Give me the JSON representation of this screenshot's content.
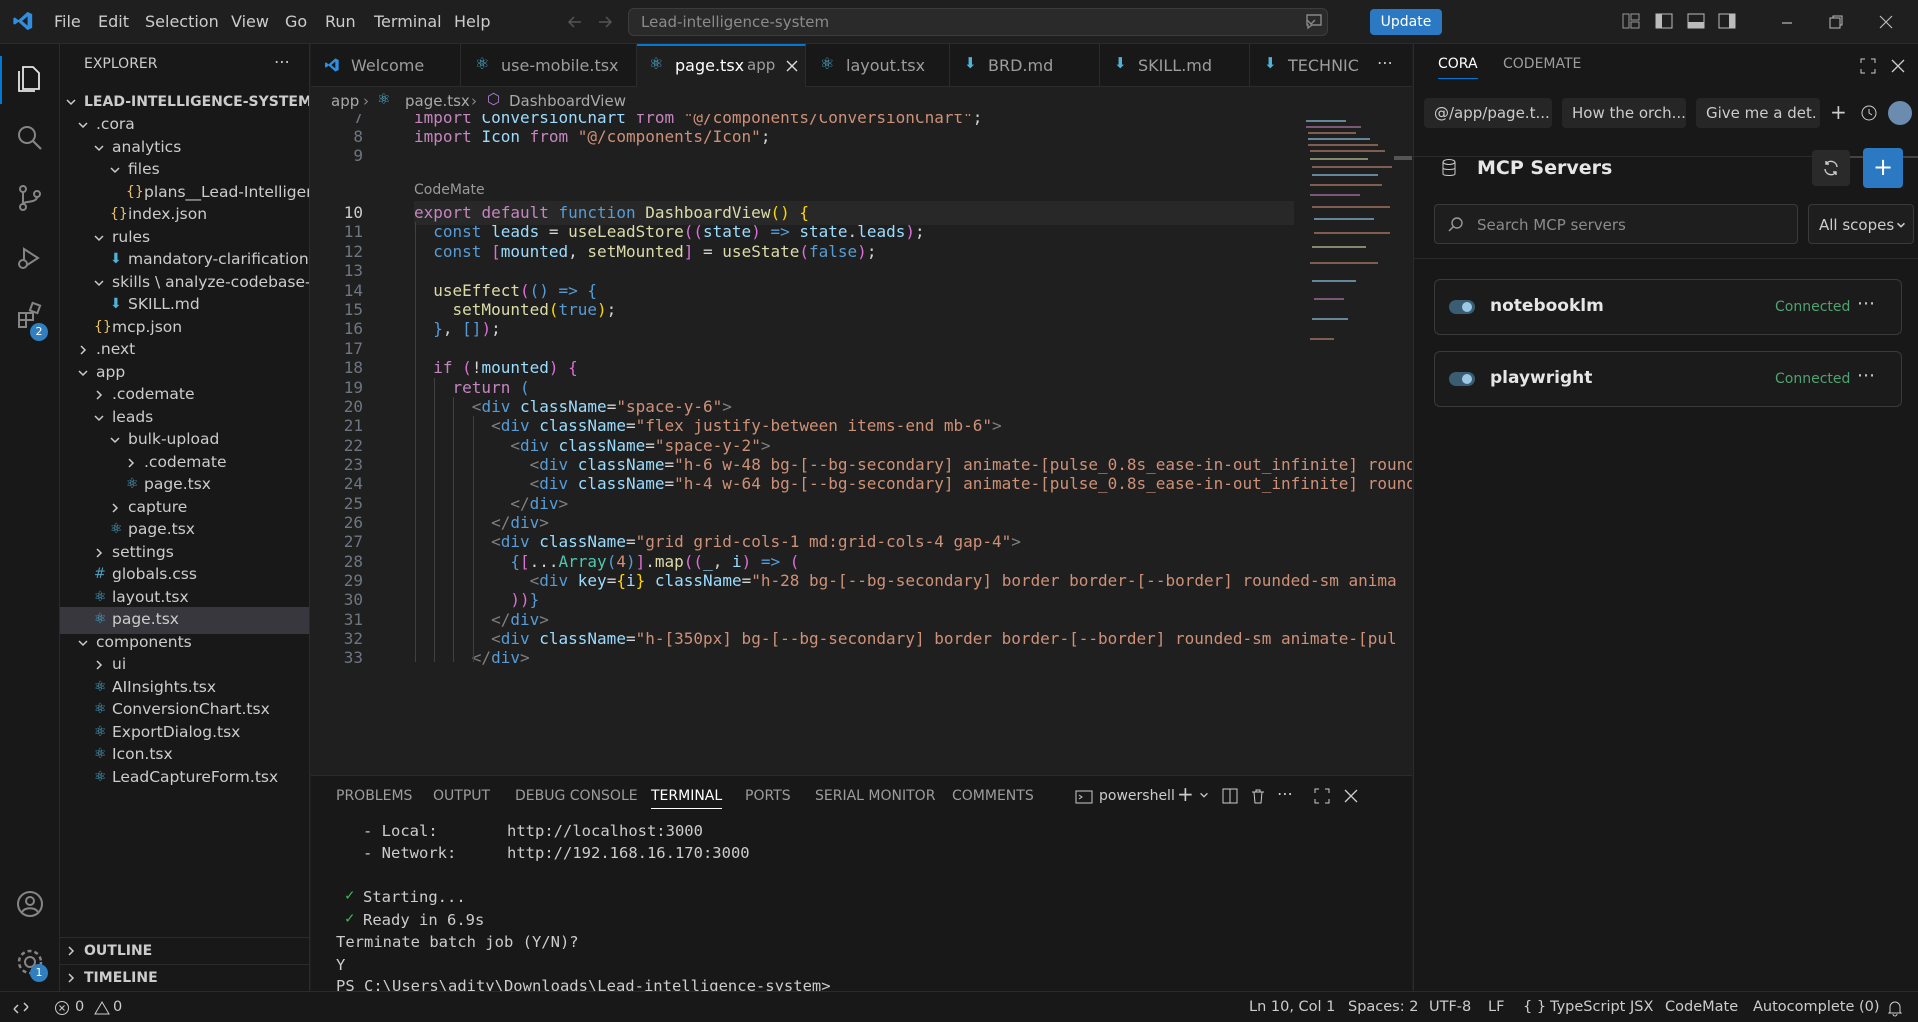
{
  "titlebar": {
    "menu": [
      "File",
      "Edit",
      "Selection",
      "View",
      "Go",
      "Run",
      "Terminal",
      "Help"
    ],
    "search_placeholder": "Lead-intelligence-system",
    "update_label": "Update"
  },
  "activitybar": {
    "extensions_badge": "2",
    "settings_badge": "1"
  },
  "explorer": {
    "title": "EXPLORER",
    "root": "LEAD-INTELLIGENCE-SYSTEM",
    "items": [
      {
        "label": ".cora",
        "icon": "chevron-down"
      },
      {
        "label": "analytics",
        "icon": "chevron-down"
      },
      {
        "label": "files",
        "icon": "chevron-down"
      },
      {
        "label": "plans__Lead-Intelligenc...",
        "icon": "json"
      },
      {
        "label": "index.json",
        "icon": "json"
      },
      {
        "label": "rules",
        "icon": "chevron-down"
      },
      {
        "label": "mandatory-clarification-...",
        "icon": "markdown"
      },
      {
        "label": "skills \\ analyze-codebase-h...",
        "icon": "chevron-down"
      },
      {
        "label": "SKILL.md",
        "icon": "markdown"
      },
      {
        "label": "mcp.json",
        "icon": "json"
      },
      {
        "label": ".next",
        "icon": "chevron-right"
      },
      {
        "label": "app",
        "icon": "chevron-down"
      },
      {
        "label": ".codemate",
        "icon": "chevron-right"
      },
      {
        "label": "leads",
        "icon": "chevron-down"
      },
      {
        "label": "bulk-upload",
        "icon": "chevron-down"
      },
      {
        "label": ".codemate",
        "icon": "chevron-right"
      },
      {
        "label": "page.tsx",
        "icon": "react"
      },
      {
        "label": "capture",
        "icon": "chevron-right"
      },
      {
        "label": "page.tsx",
        "icon": "react"
      },
      {
        "label": "settings",
        "icon": "chevron-right"
      },
      {
        "label": "globals.css",
        "icon": "css"
      },
      {
        "label": "layout.tsx",
        "icon": "react"
      },
      {
        "label": "page.tsx",
        "icon": "react"
      },
      {
        "label": "components",
        "icon": "chevron-down"
      },
      {
        "label": "ui",
        "icon": "chevron-right"
      },
      {
        "label": "AIInsights.tsx",
        "icon": "react"
      },
      {
        "label": "ConversionChart.tsx",
        "icon": "react"
      },
      {
        "label": "ExportDialog.tsx",
        "icon": "react"
      },
      {
        "label": "Icon.tsx",
        "icon": "react"
      },
      {
        "label": "LeadCaptureForm.tsx",
        "icon": "react"
      }
    ],
    "outline": "OUTLINE",
    "timeline": "TIMELINE"
  },
  "tabs": [
    {
      "label": "Welcome"
    },
    {
      "label": "use-mobile.tsx"
    },
    {
      "label": "page.tsx",
      "detail": "app"
    },
    {
      "label": "layout.tsx"
    },
    {
      "label": "BRD.md"
    },
    {
      "label": "SKILL.md"
    },
    {
      "label": "TECHNIC"
    }
  ],
  "breadcrumb": {
    "folder": "app",
    "file": "page.tsx",
    "symbol": "DashboardView"
  },
  "editor": {
    "codelens": "CodeMate",
    "line_numbers": [
      "7",
      "8",
      "9",
      "10",
      "11",
      "12",
      "13",
      "14",
      "15",
      "16",
      "17",
      "18",
      "19",
      "20",
      "21",
      "22",
      "23",
      "24",
      "25",
      "26",
      "27",
      "28",
      "29",
      "30",
      "31",
      "32",
      "33"
    ]
  },
  "panel": {
    "tabs": [
      "PROBLEMS",
      "OUTPUT",
      "DEBUG CONSOLE",
      "TERMINAL",
      "PORTS",
      "SERIAL MONITOR",
      "COMMENTS"
    ],
    "shell": "powershell",
    "terminal": {
      "local_label": "- Local:",
      "local_url": "http://localhost:3000",
      "network_label": "- Network:",
      "network_url": "http://192.168.16.170:3000",
      "starting": "Starting...",
      "ready": "Ready in 6.9s",
      "terminate": "Terminate batch job (Y/N)?",
      "answer": "Y",
      "prompt": "PS C:\\Users\\adity\\Downloads\\Lead-intelligence-system>"
    }
  },
  "chat": {
    "tabs": [
      "CORA",
      "CODEMATE"
    ],
    "chips": [
      "@/app/page.t...",
      "How the orch...",
      "Give me a det."
    ],
    "title": "MCP Servers",
    "search_placeholder": "Search MCP servers",
    "scope": "All scopes",
    "servers": [
      {
        "name": "notebooklm",
        "status": "Connected"
      },
      {
        "name": "playwright",
        "status": "Connected"
      }
    ],
    "accent": "#2b79c2",
    "status_color": "#4ea371"
  },
  "statusbar": {
    "errors": "0",
    "warnings": "0",
    "position": "Ln 10, Col 1",
    "spaces": "Spaces: 2",
    "encoding": "UTF-8",
    "eol": "LF",
    "language": "TypeScript JSX",
    "codemate": "CodeMate",
    "autocomplete": "Autocomplete (0)"
  }
}
